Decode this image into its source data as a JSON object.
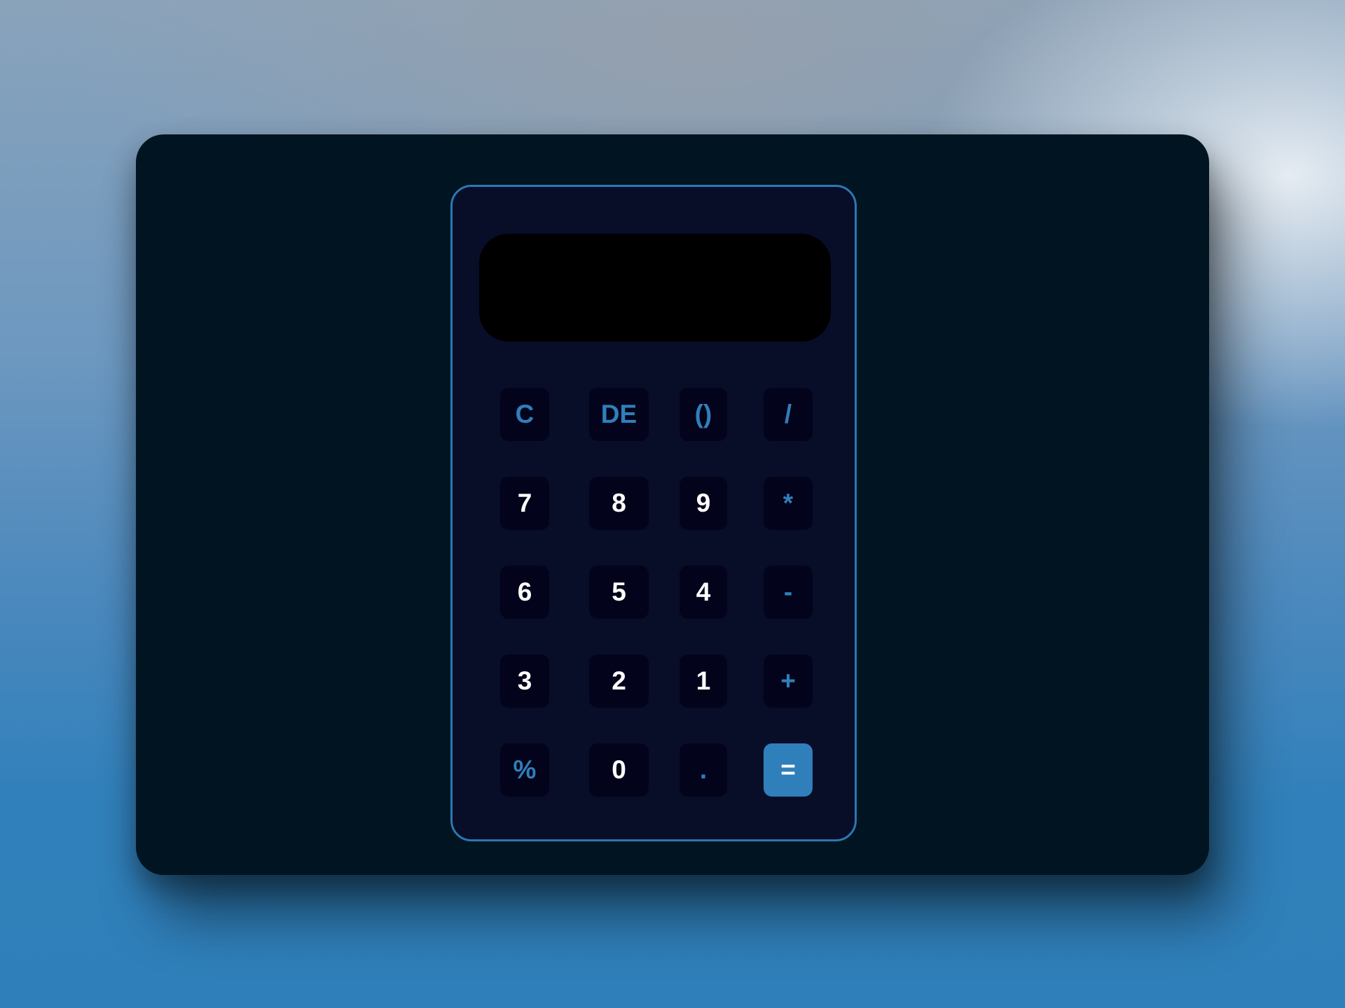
{
  "display": {
    "value": ""
  },
  "keys": {
    "clear": "C",
    "delete": "DE",
    "parentheses": "()",
    "divide": "/",
    "seven": "7",
    "eight": "8",
    "nine": "9",
    "multiply": "*",
    "six": "6",
    "five": "5",
    "four": "4",
    "subtract": "-",
    "three": "3",
    "two": "2",
    "one": "1",
    "add": "+",
    "percent": "%",
    "zero": "0",
    "decimal": ".",
    "equals": "="
  },
  "colors": {
    "window_background": "#011421",
    "calculator_background": "#080d28",
    "calculator_border": "#2b78b3",
    "display_background": "#000000",
    "key_background": "#03031b",
    "operator_text": "#2f7fba",
    "number_text": "#ffffff",
    "equals_background": "#2f7fba"
  }
}
